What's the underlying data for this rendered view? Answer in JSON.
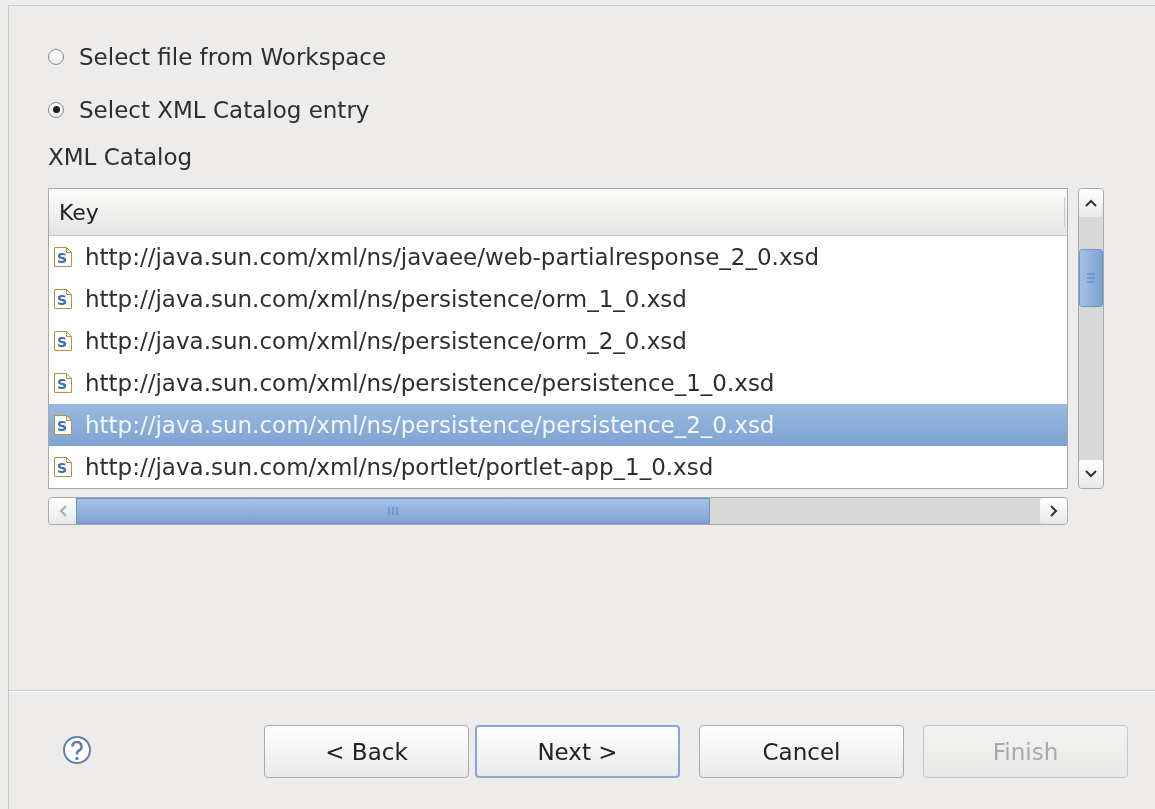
{
  "source_options": [
    {
      "label": "Select file from Workspace",
      "selected": false
    },
    {
      "label": "Select XML Catalog entry",
      "selected": true
    }
  ],
  "catalog": {
    "label": "XML Catalog",
    "columns": [
      "Key"
    ],
    "rows": [
      {
        "icon": "S",
        "key": "http://java.sun.com/xml/ns/javaee/web-partialresponse_2_0.xsd",
        "selected": false
      },
      {
        "icon": "S",
        "key": "http://java.sun.com/xml/ns/persistence/orm_1_0.xsd",
        "selected": false
      },
      {
        "icon": "S",
        "key": "http://java.sun.com/xml/ns/persistence/orm_2_0.xsd",
        "selected": false
      },
      {
        "icon": "S",
        "key": "http://java.sun.com/xml/ns/persistence/persistence_1_0.xsd",
        "selected": false
      },
      {
        "icon": "S",
        "key": "http://java.sun.com/xml/ns/persistence/persistence_2_0.xsd",
        "selected": true
      },
      {
        "icon": "S",
        "key": "http://java.sun.com/xml/ns/portlet/portlet-app_1_0.xsd",
        "selected": false
      }
    ]
  },
  "buttons": [
    {
      "label": "< Back",
      "disabled": false,
      "default": false
    },
    {
      "label": "Next >",
      "disabled": false,
      "default": true
    },
    {
      "label": "Cancel",
      "disabled": false,
      "default": false
    },
    {
      "label": "Finish",
      "disabled": true,
      "default": false
    }
  ]
}
